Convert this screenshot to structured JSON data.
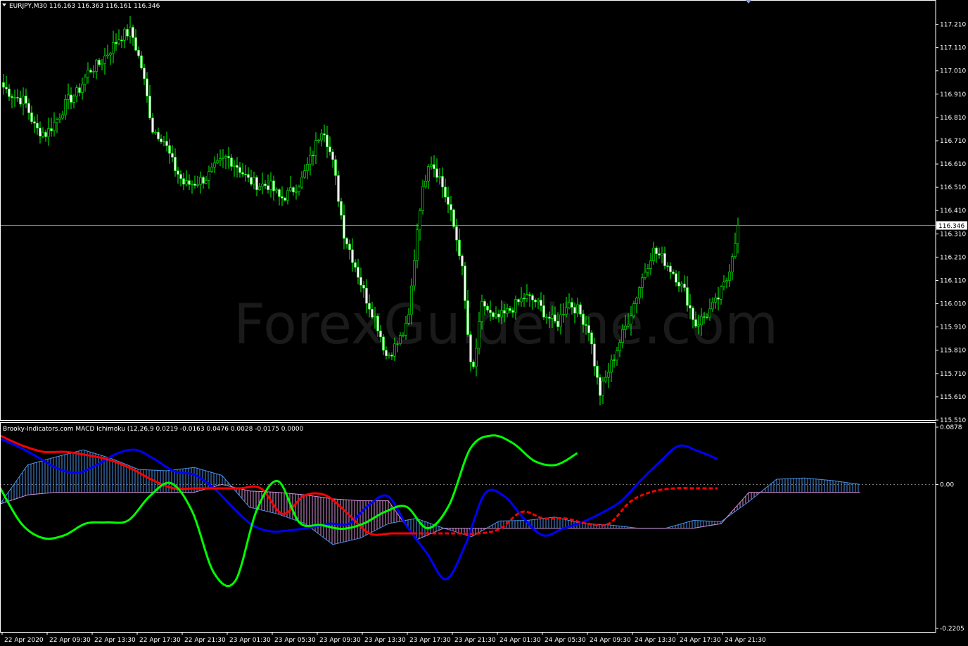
{
  "colors": {
    "background": "#000000",
    "bull": "#000000",
    "bear": "#ffffff",
    "wick": "#00ff00",
    "axis": "#ffffff",
    "price_line": "#7f8cb3",
    "macd": "#0000ff",
    "signal": "#ff0000",
    "green_line": "#00ff00",
    "cloud_up": "#4a90e2",
    "cloud_down": "#d28fd6"
  },
  "main": {
    "title": "EURJPY,M30  116.163 116.363 116.161 116.346",
    "watermark": "ForexGuideline.com",
    "current_price": "116.346"
  },
  "sub": {
    "title": "Brooky-Indicators.com MACD Ichimoku (12,26,9 0.0219 -0.0163 0.0476 0.0028 -0.0175 0.0000",
    "top_label": "0.0878",
    "zero_label": "0.00",
    "bottom_label": "-0.2205"
  },
  "chart_data": [
    {
      "type": "candlestick",
      "title": "EURJPY,M30",
      "ylim": [
        115.51,
        117.26
      ],
      "y_ticks": [
        117.21,
        117.11,
        117.01,
        116.91,
        116.81,
        116.71,
        116.61,
        116.51,
        116.41,
        116.31,
        116.21,
        116.11,
        116.01,
        115.91,
        115.81,
        115.71,
        115.61,
        115.51
      ],
      "x_labels": [
        "22 Apr 2020",
        "22 Apr 09:30",
        "22 Apr 13:30",
        "22 Apr 17:30",
        "22 Apr 21:30",
        "23 Apr 01:30",
        "23 Apr 05:30",
        "23 Apr 09:30",
        "23 Apr 13:30",
        "23 Apr 17:30",
        "23 Apr 21:30",
        "24 Apr 01:30",
        "24 Apr 05:30",
        "24 Apr 09:30",
        "24 Apr 13:30",
        "24 Apr 17:30",
        "24 Apr 21:30"
      ],
      "current_price": 116.346,
      "close_path": [
        116.94,
        116.9,
        116.88,
        116.76,
        116.74,
        116.8,
        116.88,
        116.92,
        117.01,
        117.04,
        117.1,
        117.16,
        117.18,
        117.02,
        116.76,
        116.72,
        116.6,
        116.52,
        116.53,
        116.55,
        116.6,
        116.64,
        116.6,
        116.54,
        116.52,
        116.52,
        116.46,
        116.49,
        116.54,
        116.65,
        116.78,
        116.6,
        116.31,
        116.18,
        116.04,
        115.94,
        115.78,
        115.84,
        115.92,
        116.4,
        116.64,
        116.55,
        116.4,
        116.2,
        115.68,
        116.02,
        115.94,
        115.96,
        116.0,
        116.04,
        116.02,
        115.96,
        115.92,
        116.02,
        115.98,
        115.9,
        115.62,
        115.74,
        115.86,
        115.98,
        116.12,
        116.24,
        116.2,
        116.14,
        116.06,
        115.92,
        115.96,
        116.02,
        116.12,
        116.346
      ]
    },
    {
      "type": "line",
      "title": "MACD Ichimoku (12,26,9)",
      "ylim": [
        -0.2205,
        0.0878
      ],
      "series": [
        {
          "values": [
            0.07,
            0.057,
            0.041,
            0.024,
            0.018,
            0.03,
            0.047,
            0.053,
            0.038,
            0.02,
            0.015,
            -0.005,
            -0.035,
            -0.062,
            -0.072,
            -0.07,
            -0.066,
            -0.06,
            -0.06,
            -0.032,
            -0.018,
            -0.065,
            -0.105,
            -0.145,
            -0.092,
            -0.014,
            -0.018,
            -0.052,
            -0.078,
            -0.068,
            -0.058,
            -0.044,
            -0.026,
            0.005,
            0.034,
            0.059,
            0.051,
            0.039
          ],
          "style": "solid",
          "color_key": "macd",
          "end": 0.767
        },
        {
          "values": [
            0.075,
            0.06,
            0.05,
            0.05,
            0.045,
            0.038,
            0.025,
            0.007,
            -0.006,
            -0.006,
            -0.006,
            -0.006,
            -0.006,
            -0.045,
            -0.017,
            -0.017,
            -0.045,
            -0.075,
            -0.075,
            -0.075,
            -0.075,
            -0.075,
            -0.075,
            -0.068,
            -0.042,
            -0.052,
            -0.052,
            -0.06,
            -0.06,
            -0.026,
            -0.011,
            -0.006,
            -0.006,
            -0.006
          ],
          "style": "mixed",
          "color_key": "signal",
          "end": 0.767,
          "dash_from": 0.565
        },
        {
          "values": [
            -0.005,
            -0.06,
            -0.082,
            -0.078,
            -0.06,
            -0.058,
            -0.055,
            -0.018,
            0.002,
            -0.042,
            -0.135,
            -0.148,
            -0.04,
            0.005,
            -0.058,
            -0.062,
            -0.068,
            -0.06,
            -0.042,
            -0.034,
            -0.067,
            -0.032,
            0.055,
            0.075,
            0.063,
            0.036,
            0.03,
            0.048
          ],
          "style": "solid",
          "color_key": "green_line",
          "end": 0.617
        }
      ],
      "cloud": {
        "span_a": [
          -0.03,
          0.03,
          0.042,
          0.053,
          0.04,
          0.023,
          0.021,
          0.026,
          0.014,
          -0.035,
          -0.045,
          -0.06,
          -0.092,
          -0.082,
          -0.06,
          -0.052,
          -0.067,
          -0.08,
          -0.056,
          -0.055,
          -0.05,
          -0.06,
          -0.062,
          -0.067,
          -0.067,
          -0.055,
          -0.057,
          -0.026,
          0.008,
          0.01,
          0.006,
          0.0
        ],
        "span_b": [
          -0.03,
          -0.016,
          -0.012,
          -0.012,
          -0.012,
          -0.012,
          -0.012,
          -0.012,
          0.0,
          -0.01,
          -0.012,
          -0.016,
          -0.022,
          -0.025,
          -0.025,
          -0.085,
          -0.067,
          -0.067,
          -0.067,
          -0.067,
          -0.067,
          -0.067,
          -0.067,
          -0.067,
          -0.067,
          -0.067,
          -0.06,
          -0.012,
          -0.012,
          -0.012,
          -0.012,
          -0.012
        ],
        "end": 0.919
      }
    }
  ]
}
